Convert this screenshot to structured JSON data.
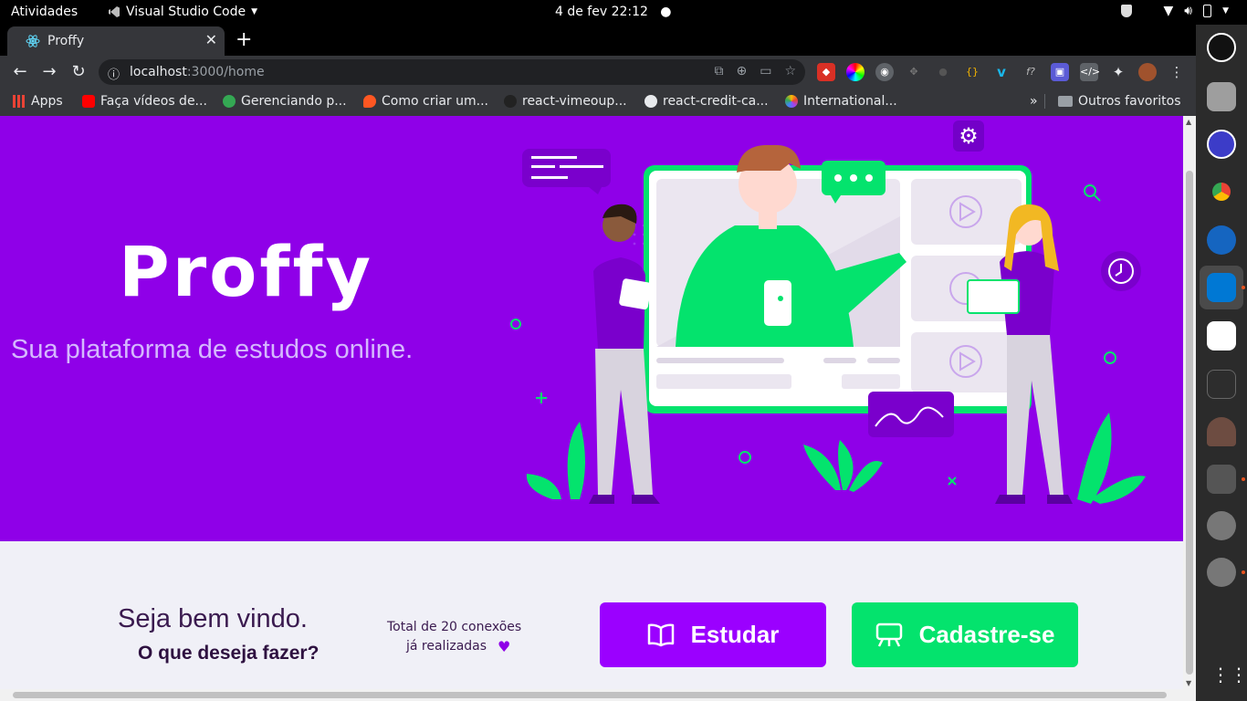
{
  "topbar": {
    "activities": "Atividades",
    "app_name": "Visual Studio Code",
    "clock": "4 de fev  22:12"
  },
  "browser": {
    "tab_title": "Proffy",
    "url_host": "localhost",
    "url_path": ":3000/home",
    "bookmarks": [
      "Apps",
      "Faça vídeos de...",
      "Gerenciando p...",
      "Como criar um...",
      "react-vimeoup...",
      "react-credit-ca...",
      "International...",
      "Outros favoritos"
    ],
    "more": "»"
  },
  "page": {
    "logo": "Proffy",
    "tagline": "Sua plataforma de estudos online.",
    "welcome": "Seja bem vindo.",
    "question": "O que deseja fazer?",
    "total_line1": "Total de 20 conexões",
    "total_line2": "já realizadas",
    "study_button": "Estudar",
    "give_classes_button": "Cadastre-se"
  },
  "colors": {
    "primary": "#8f00e8",
    "primary_button": "#9b00ff",
    "secondary": "#04e36d",
    "background": "#f0f0f7"
  }
}
